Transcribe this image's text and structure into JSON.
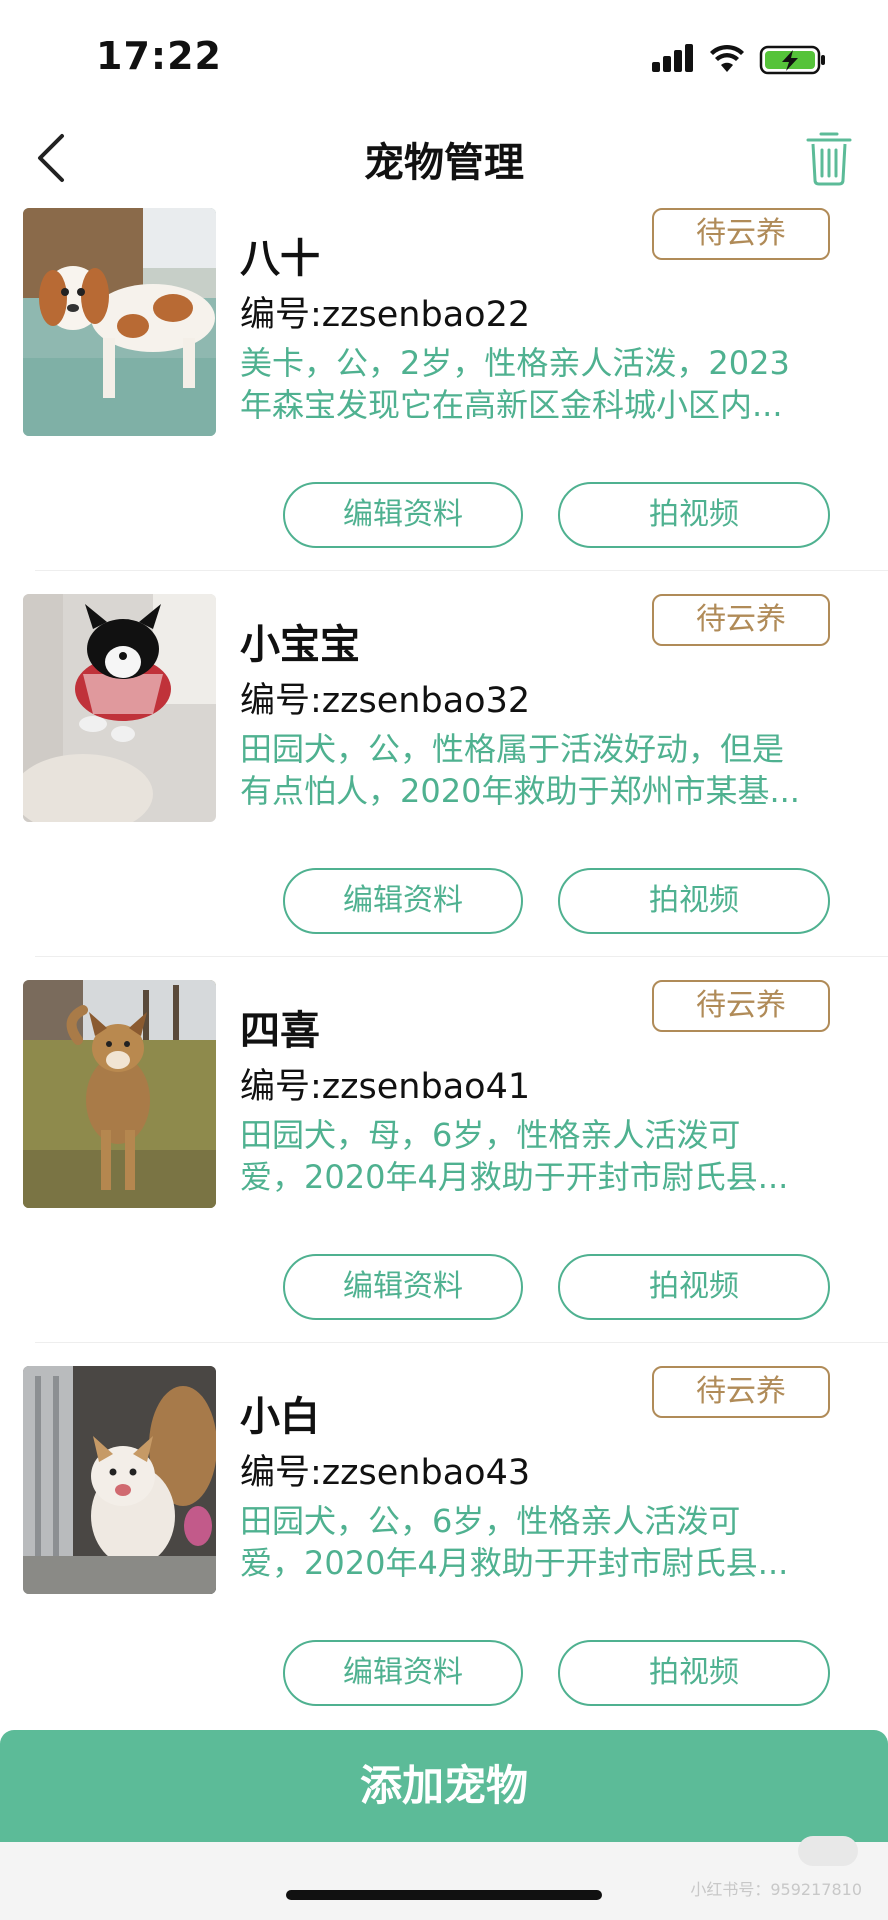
{
  "status_bar": {
    "time": "17:22"
  },
  "header": {
    "title": "宠物管理"
  },
  "pets": [
    {
      "name": "八十",
      "id_text": "编号:zzsenbao22",
      "desc_line1": "美卡，公，2岁，性格亲人活泼，2023",
      "desc_line2": "年森宝发现它在高新区金科城小区内...",
      "status": "待云养",
      "edit_label": "编辑资料",
      "video_label": "拍视频"
    },
    {
      "name": "小宝宝",
      "id_text": "编号:zzsenbao32",
      "desc_line1": "田园犬，公，性格属于活泼好动，但是",
      "desc_line2": "有点怕人，2020年救助于郑州市某基...",
      "status": "待云养",
      "edit_label": "编辑资料",
      "video_label": "拍视频"
    },
    {
      "name": "四喜",
      "id_text": "编号:zzsenbao41",
      "desc_line1": "田园犬，母，6岁，性格亲人活泼可",
      "desc_line2": "爱，2020年4月救助于开封市尉氏县...",
      "status": "待云养",
      "edit_label": "编辑资料",
      "video_label": "拍视频"
    },
    {
      "name": "小白",
      "id_text": "编号:zzsenbao43",
      "desc_line1": "田园犬，公，6岁，性格亲人活泼可",
      "desc_line2": "爱，2020年4月救助于开封市尉氏县...",
      "status": "待云养",
      "edit_label": "编辑资料",
      "video_label": "拍视频"
    }
  ],
  "footer": {
    "add_label": "添加宠物",
    "watermark": "小红书号：959217810"
  },
  "colors": {
    "accent_green": "#5cbb98",
    "text_green": "#4fb190",
    "tag_brown": "#b08b58"
  },
  "icons": [
    "back-chevron-icon",
    "trash-icon",
    "signal-icon",
    "wifi-icon",
    "battery-charging-icon"
  ]
}
